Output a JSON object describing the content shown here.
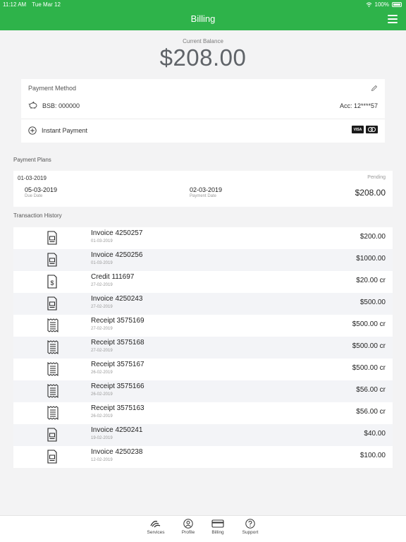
{
  "status_bar": {
    "time": "11:12 AM",
    "date": "Tue Mar 12",
    "battery": "100%"
  },
  "nav": {
    "title": "Billing"
  },
  "balance": {
    "label": "Current Balance",
    "value": "$208.00"
  },
  "payment_method": {
    "title": "Payment Method",
    "bsb": "BSB: 000000",
    "account": "Acc: 12****57",
    "instant_payment": "Instant Payment",
    "visa_label": "VISA"
  },
  "payment_plans": {
    "section_label": "Payment Plans",
    "plan": {
      "date": "01-03-2019",
      "status": "Pending",
      "due_date": "05-03-2019",
      "due_date_label": "Due Date",
      "payment_date": "02-03-2019",
      "payment_date_label": "Payment Date",
      "amount": "$208.00"
    }
  },
  "transactions": {
    "section_label": "Transaction History",
    "items": [
      {
        "title": "Invoice 4250257",
        "date": "01-03-2019",
        "amount": "$200.00",
        "icon": "invoice-icon"
      },
      {
        "title": "Invoice 4250256",
        "date": "01-03-2019",
        "amount": "$1000.00",
        "icon": "invoice-icon"
      },
      {
        "title": "Credit 111697",
        "date": "27-02-2019",
        "amount": "$20.00 cr",
        "icon": "credit-icon"
      },
      {
        "title": "Invoice 4250243",
        "date": "27-02-2019",
        "amount": "$500.00",
        "icon": "invoice-icon"
      },
      {
        "title": "Receipt 3575169",
        "date": "27-02-2019",
        "amount": "$500.00 cr",
        "icon": "receipt-icon"
      },
      {
        "title": "Receipt 3575168",
        "date": "27-02-2019",
        "amount": "$500.00 cr",
        "icon": "receipt-icon"
      },
      {
        "title": "Receipt 3575167",
        "date": "26-02-2019",
        "amount": "$500.00 cr",
        "icon": "receipt-icon"
      },
      {
        "title": "Receipt 3575166",
        "date": "26-02-2019",
        "amount": "$56.00 cr",
        "icon": "receipt-icon"
      },
      {
        "title": "Receipt 3575163",
        "date": "26-02-2019",
        "amount": "$56.00 cr",
        "icon": "receipt-icon"
      },
      {
        "title": "Invoice 4250241",
        "date": "19-02-2019",
        "amount": "$40.00",
        "icon": "invoice-icon"
      },
      {
        "title": "Invoice 4250238",
        "date": "12-02-2019",
        "amount": "$100.00",
        "icon": "invoice-icon"
      }
    ]
  },
  "tab_bar": {
    "services": "Services",
    "profile": "Profile",
    "billing": "Billing",
    "support": "Support"
  },
  "colors": {
    "brand": "#2eb34a",
    "balance": "#5f6368"
  }
}
